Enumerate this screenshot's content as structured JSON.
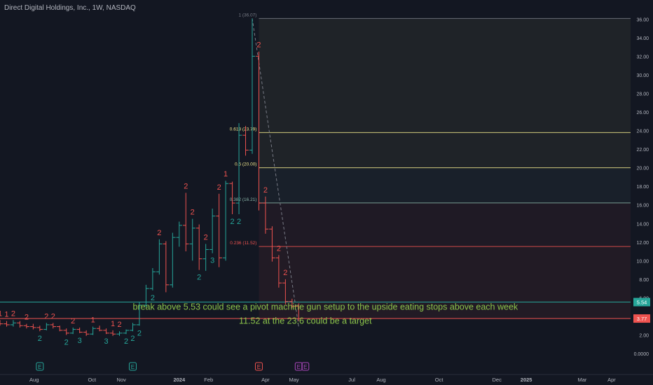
{
  "chart_data": {
    "type": "candlestick",
    "title": "Direct Digital Holdings, Inc., 1W, NASDAQ",
    "y_ticks": [
      "36.00",
      "34.00",
      "32.00",
      "30.00",
      "28.00",
      "26.00",
      "24.00",
      "22.00",
      "20.00",
      "18.00",
      "16.00",
      "14.00",
      "12.00",
      "10.00",
      "8.00",
      "6.00",
      "4.00",
      "2.00",
      "0.0000"
    ],
    "y_tick_values": [
      36,
      34,
      32,
      30,
      28,
      26,
      24,
      22,
      20,
      18,
      16,
      14,
      12,
      10,
      8,
      6,
      4,
      2,
      0
    ],
    "ylim": [
      -1.5,
      37.3
    ],
    "x_ticks": [
      "Aug",
      "Oct",
      "Nov",
      "2024",
      "Feb",
      "Apr",
      "May",
      "Jul",
      "Aug",
      "Oct",
      "Dec",
      "2025",
      "Mar",
      "Apr"
    ],
    "x_tick_dates": [
      "2023-08-01",
      "2023-10-01",
      "2023-11-01",
      "2024-01-01",
      "2024-02-01",
      "2024-04-01",
      "2024-05-01",
      "2024-07-01",
      "2024-08-01",
      "2024-10-01",
      "2024-12-01",
      "2025-01-01",
      "2025-03-01",
      "2025-04-01"
    ],
    "xlim": [
      "2023-06-26",
      "2025-04-21"
    ],
    "price_labels": [
      {
        "text": "5.54",
        "value": 5.54,
        "color": "#26a69a"
      },
      {
        "text": "3.77",
        "value": 3.77,
        "color": "#ef5350"
      }
    ],
    "fib_levels": [
      {
        "label": "1 (36.07)",
        "value": 36.07,
        "color": "#787b86"
      },
      {
        "label": "0.618 (23.79)",
        "value": 23.79,
        "color": "#f0e68c"
      },
      {
        "label": "0.5 (20.00)",
        "value": 20.0,
        "color": "#f0e68c"
      },
      {
        "label": "0.382 (16.21)",
        "value": 16.21,
        "color": "#89b4a8"
      },
      {
        "label": "0.236 (11.52)",
        "value": 11.52,
        "color": "#ef5350"
      }
    ],
    "fib_start_date": "2024-03-25",
    "horizontal_lines": [
      {
        "value": 5.54,
        "color": "#26a69a"
      },
      {
        "value": 3.77,
        "color": "#ef5350"
      }
    ],
    "trendline": {
      "from": {
        "date": "2024-03-18",
        "value": 36.07
      },
      "to": {
        "date": "2024-05-06",
        "value": 2.9
      }
    },
    "annotations": [
      {
        "text": "break above 5.53 could see a pivot machine gun setup to the upside eating stops above each week",
        "date": "2023-11-13",
        "value": 4.7
      },
      {
        "text": "11.52 at the 23.6 could be a target",
        "date": "2024-03-04",
        "value": 3.2
      }
    ],
    "candles": [
      {
        "date": "2023-06-26",
        "open": 3.3,
        "high": 3.6,
        "low": 3.0,
        "close": 3.2
      },
      {
        "date": "2023-07-03",
        "open": 3.2,
        "high": 3.5,
        "low": 2.9,
        "close": 3.1
      },
      {
        "date": "2023-07-10",
        "open": 3.1,
        "high": 3.6,
        "low": 2.9,
        "close": 3.3
      },
      {
        "date": "2023-07-17",
        "open": 3.3,
        "high": 3.5,
        "low": 2.8,
        "close": 3.0
      },
      {
        "date": "2023-07-24",
        "open": 3.0,
        "high": 3.2,
        "low": 2.7,
        "close": 2.9
      },
      {
        "date": "2023-07-31",
        "open": 2.9,
        "high": 3.2,
        "low": 2.6,
        "close": 2.8
      },
      {
        "date": "2023-08-07",
        "open": 2.8,
        "high": 3.0,
        "low": 2.4,
        "close": 2.6
      },
      {
        "date": "2023-08-14",
        "open": 2.6,
        "high": 3.3,
        "low": 2.5,
        "close": 3.1
      },
      {
        "date": "2023-08-21",
        "open": 3.1,
        "high": 3.3,
        "low": 2.7,
        "close": 2.9
      },
      {
        "date": "2023-08-28",
        "open": 2.9,
        "high": 3.0,
        "low": 2.4,
        "close": 2.5
      },
      {
        "date": "2023-09-04",
        "open": 2.5,
        "high": 2.7,
        "low": 2.0,
        "close": 2.2
      },
      {
        "date": "2023-09-11",
        "open": 2.2,
        "high": 2.8,
        "low": 2.1,
        "close": 2.6
      },
      {
        "date": "2023-09-18",
        "open": 2.6,
        "high": 2.8,
        "low": 2.2,
        "close": 2.3
      },
      {
        "date": "2023-09-25",
        "open": 2.3,
        "high": 2.5,
        "low": 1.9,
        "close": 2.1
      },
      {
        "date": "2023-10-02",
        "open": 2.1,
        "high": 2.9,
        "low": 2.0,
        "close": 2.7
      },
      {
        "date": "2023-10-09",
        "open": 2.7,
        "high": 3.0,
        "low": 2.4,
        "close": 2.5
      },
      {
        "date": "2023-10-16",
        "open": 2.5,
        "high": 2.7,
        "low": 2.1,
        "close": 2.2
      },
      {
        "date": "2023-10-23",
        "open": 2.2,
        "high": 2.5,
        "low": 1.9,
        "close": 2.1
      },
      {
        "date": "2023-10-30",
        "open": 2.1,
        "high": 2.4,
        "low": 1.9,
        "close": 2.2
      },
      {
        "date": "2023-11-06",
        "open": 2.2,
        "high": 2.6,
        "low": 2.1,
        "close": 2.5
      },
      {
        "date": "2023-11-13",
        "open": 2.5,
        "high": 3.3,
        "low": 2.4,
        "close": 3.1
      },
      {
        "date": "2023-11-20",
        "open": 3.1,
        "high": 5.5,
        "low": 3.0,
        "close": 5.2
      },
      {
        "date": "2023-11-27",
        "open": 5.2,
        "high": 7.4,
        "low": 5.0,
        "close": 7.0
      },
      {
        "date": "2023-12-04",
        "open": 7.0,
        "high": 9.2,
        "low": 6.8,
        "close": 8.8
      },
      {
        "date": "2023-12-11",
        "open": 8.8,
        "high": 12.3,
        "low": 8.5,
        "close": 11.8
      },
      {
        "date": "2023-12-18",
        "open": 11.8,
        "high": 12.1,
        "low": 6.6,
        "close": 7.4
      },
      {
        "date": "2023-12-25",
        "open": 7.4,
        "high": 13.0,
        "low": 7.1,
        "close": 12.5
      },
      {
        "date": "2024-01-01",
        "open": 12.5,
        "high": 14.2,
        "low": 11.5,
        "close": 13.8
      },
      {
        "date": "2024-01-08",
        "open": 13.8,
        "high": 17.3,
        "low": 11.0,
        "close": 11.8
      },
      {
        "date": "2024-01-15",
        "open": 11.8,
        "high": 14.5,
        "low": 10.0,
        "close": 13.5
      },
      {
        "date": "2024-01-22",
        "open": 13.5,
        "high": 13.9,
        "low": 9.0,
        "close": 10.2
      },
      {
        "date": "2024-01-29",
        "open": 10.2,
        "high": 11.8,
        "low": 8.9,
        "close": 11.2
      },
      {
        "date": "2024-02-05",
        "open": 11.2,
        "high": 15.6,
        "low": 10.8,
        "close": 14.8
      },
      {
        "date": "2024-02-12",
        "open": 14.8,
        "high": 17.2,
        "low": 9.3,
        "close": 10.3
      },
      {
        "date": "2024-02-19",
        "open": 10.3,
        "high": 18.6,
        "low": 10.0,
        "close": 18.3
      },
      {
        "date": "2024-02-26",
        "open": 18.3,
        "high": 18.5,
        "low": 15.0,
        "close": 16.2
      },
      {
        "date": "2024-03-04",
        "open": 16.2,
        "high": 24.8,
        "low": 15.0,
        "close": 23.5
      },
      {
        "date": "2024-03-11",
        "open": 23.5,
        "high": 24.5,
        "low": 21.3,
        "close": 21.9
      },
      {
        "date": "2024-03-18",
        "open": 21.9,
        "high": 36.07,
        "low": 21.5,
        "close": 32.0
      },
      {
        "date": "2024-03-25",
        "open": 32.0,
        "high": 32.5,
        "low": 15.4,
        "close": 16.2
      },
      {
        "date": "2024-04-01",
        "open": 16.2,
        "high": 16.9,
        "low": 12.9,
        "close": 13.4
      },
      {
        "date": "2024-04-08",
        "open": 13.4,
        "high": 13.7,
        "low": 9.9,
        "close": 10.3
      },
      {
        "date": "2024-04-15",
        "open": 10.3,
        "high": 10.6,
        "low": 7.1,
        "close": 7.6
      },
      {
        "date": "2024-04-22",
        "open": 7.6,
        "high": 8.0,
        "low": 5.3,
        "close": 5.6
      },
      {
        "date": "2024-04-29",
        "open": 5.6,
        "high": 5.9,
        "low": 4.9,
        "close": 5.1
      },
      {
        "date": "2024-05-06",
        "open": 5.1,
        "high": 5.4,
        "low": 3.5,
        "close": 3.77
      }
    ],
    "td_counts": [
      {
        "date": "2023-06-26",
        "text": "1",
        "color": "#ef5350",
        "pos": "above"
      },
      {
        "date": "2023-07-03",
        "text": "1",
        "color": "#ef5350",
        "pos": "above"
      },
      {
        "date": "2023-07-10",
        "text": "2",
        "color": "#ef5350",
        "pos": "above"
      },
      {
        "date": "2023-07-24",
        "text": "2",
        "color": "#ef5350",
        "pos": "above"
      },
      {
        "date": "2023-08-07",
        "text": "2",
        "color": "#26a69a",
        "pos": "below"
      },
      {
        "date": "2023-08-14",
        "text": "2",
        "color": "#ef5350",
        "pos": "above"
      },
      {
        "date": "2023-08-21",
        "text": "2",
        "color": "#ef5350",
        "pos": "above"
      },
      {
        "date": "2023-09-04",
        "text": "2",
        "color": "#26a69a",
        "pos": "below"
      },
      {
        "date": "2023-09-11",
        "text": "2",
        "color": "#ef5350",
        "pos": "above"
      },
      {
        "date": "2023-09-18",
        "text": "3",
        "color": "#26a69a",
        "pos": "below"
      },
      {
        "date": "2023-10-02",
        "text": "1",
        "color": "#ef5350",
        "pos": "above"
      },
      {
        "date": "2023-10-16",
        "text": "3",
        "color": "#26a69a",
        "pos": "below"
      },
      {
        "date": "2023-10-23",
        "text": "1",
        "color": "#ef5350",
        "pos": "above"
      },
      {
        "date": "2023-10-30",
        "text": "2",
        "color": "#ef5350",
        "pos": "above"
      },
      {
        "date": "2023-11-06",
        "text": "2",
        "color": "#26a69a",
        "pos": "below"
      },
      {
        "date": "2023-11-13",
        "text": "2",
        "color": "#26a69a",
        "pos": "below"
      },
      {
        "date": "2023-11-20",
        "text": "2",
        "color": "#26a69a",
        "pos": "below"
      },
      {
        "date": "2023-12-04",
        "text": "2",
        "color": "#26a69a",
        "pos": "below"
      },
      {
        "date": "2023-12-11",
        "text": "2",
        "color": "#ef5350",
        "pos": "above"
      },
      {
        "date": "2024-01-08",
        "text": "2",
        "color": "#ef5350",
        "pos": "above"
      },
      {
        "date": "2024-01-15",
        "text": "2",
        "color": "#ef5350",
        "pos": "above"
      },
      {
        "date": "2024-01-22",
        "text": "2",
        "color": "#26a69a",
        "pos": "below"
      },
      {
        "date": "2024-01-29",
        "text": "2",
        "color": "#ef5350",
        "pos": "above"
      },
      {
        "date": "2024-02-05",
        "text": "3",
        "color": "#26a69a",
        "pos": "below"
      },
      {
        "date": "2024-02-12",
        "text": "2",
        "color": "#ef5350",
        "pos": "above"
      },
      {
        "date": "2024-02-19",
        "text": "1",
        "color": "#ef5350",
        "pos": "above"
      },
      {
        "date": "2024-02-26",
        "text": "2",
        "color": "#26a69a",
        "pos": "below"
      },
      {
        "date": "2024-03-04",
        "text": "2",
        "color": "#26a69a",
        "pos": "below"
      },
      {
        "date": "2024-03-25",
        "text": "2",
        "color": "#ef5350",
        "pos": "above"
      },
      {
        "date": "2024-04-01",
        "text": "2",
        "color": "#ef5350",
        "pos": "above"
      },
      {
        "date": "2024-04-15",
        "text": "2",
        "color": "#ef5350",
        "pos": "above"
      },
      {
        "date": "2024-04-22",
        "text": "2",
        "color": "#ef5350",
        "pos": "above"
      }
    ],
    "event_markers": [
      {
        "date": "2023-08-07",
        "text": "E",
        "color": "#26a69a"
      },
      {
        "date": "2023-11-13",
        "text": "E",
        "color": "#26a69a"
      },
      {
        "date": "2024-03-25",
        "text": "E",
        "color": "#ef5350"
      },
      {
        "date": "2024-05-06",
        "text": "E",
        "color": "#ab47bc"
      },
      {
        "date": "2024-05-13",
        "text": "E",
        "color": "#ab47bc"
      }
    ],
    "grid": false,
    "colors": {
      "background": "#131722",
      "up": "#26a69a",
      "down": "#ef5350",
      "axis_text": "#b2b5be"
    }
  }
}
